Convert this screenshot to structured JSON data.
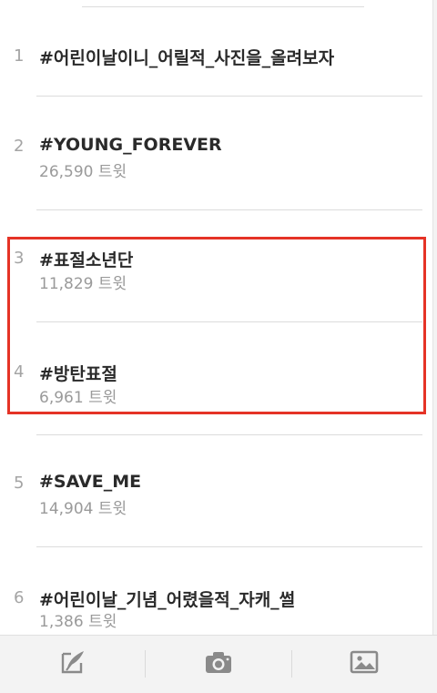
{
  "trends": [
    {
      "rank": "1",
      "tag": "#어린이날이니_어릴적_사진을_올려보자",
      "count": ""
    },
    {
      "rank": "2",
      "tag": "#YOUNG_FOREVER",
      "count": "26,590 트윗"
    },
    {
      "rank": "3",
      "tag": "#표절소년단",
      "count": "11,829 트윗"
    },
    {
      "rank": "4",
      "tag": "#방탄표절",
      "count": "6,961 트윗"
    },
    {
      "rank": "5",
      "tag": "#SAVE_ME",
      "count": "14,904 트윗"
    },
    {
      "rank": "6",
      "tag": "#어린이날_기념_어렸을적_자캐_썰",
      "count": "1,386 트윗"
    }
  ],
  "colors": {
    "highlight": "#e53326",
    "icon": "#8a8a8a"
  },
  "toolbar": {
    "icons": [
      "compose-icon",
      "camera-icon",
      "image-icon"
    ]
  }
}
